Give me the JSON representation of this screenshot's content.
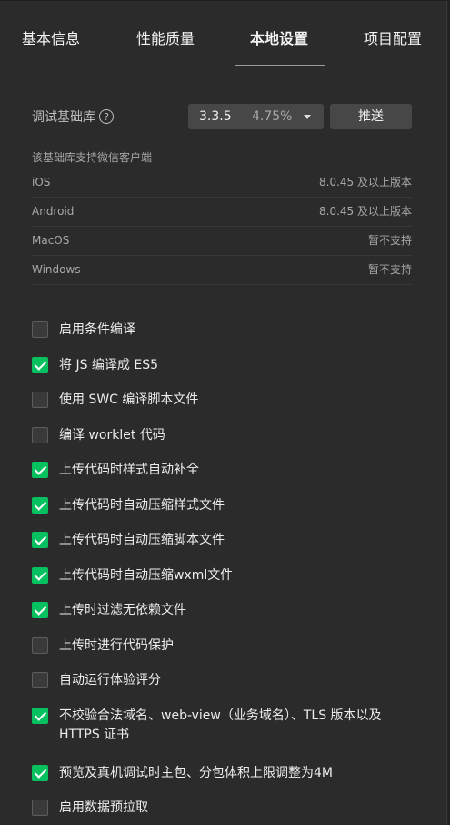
{
  "tabs": [
    {
      "label": "基本信息"
    },
    {
      "label": "性能质量"
    },
    {
      "label": "本地设置"
    },
    {
      "label": "项目配置"
    }
  ],
  "active_tab": "本地设置",
  "debug_lib": {
    "label": "调试基础库",
    "help_icon": "?",
    "version": "3.3.5",
    "usage_percent": "4.75%",
    "push_label": "推送"
  },
  "support": {
    "title": "该基础库支持微信客户端",
    "rows": [
      {
        "os": "iOS",
        "requirement": "8.0.45 及以上版本"
      },
      {
        "os": "Android",
        "requirement": "8.0.45 及以上版本"
      },
      {
        "os": "MacOS",
        "requirement": "暂不支持"
      },
      {
        "os": "Windows",
        "requirement": "暂不支持"
      }
    ]
  },
  "options": [
    {
      "label": "启用条件编译",
      "checked": false
    },
    {
      "label": "将 JS 编译成 ES5",
      "checked": true
    },
    {
      "label": "使用 SWC 编译脚本文件",
      "checked": false
    },
    {
      "label": "编译 worklet 代码",
      "checked": false
    },
    {
      "label": "上传代码时样式自动补全",
      "checked": true
    },
    {
      "label": "上传代码时自动压缩样式文件",
      "checked": true
    },
    {
      "label": "上传代码时自动压缩脚本文件",
      "checked": true
    },
    {
      "label": "上传代码时自动压缩wxml文件",
      "checked": true
    },
    {
      "label": "上传时过滤无依赖文件",
      "checked": true
    },
    {
      "label": "上传时进行代码保护",
      "checked": false
    },
    {
      "label": "自动运行体验评分",
      "checked": false
    },
    {
      "label": "不校验合法域名、web-view（业务域名）、TLS 版本以及 HTTPS 证书",
      "checked": true
    },
    {
      "label": "预览及真机调试时主包、分包体积上限调整为4M",
      "checked": true
    },
    {
      "label": "启用数据预拉取",
      "checked": false
    }
  ],
  "colors": {
    "background": "#2b2b2b",
    "accent_green": "#07c160",
    "button_bg": "#474747"
  }
}
